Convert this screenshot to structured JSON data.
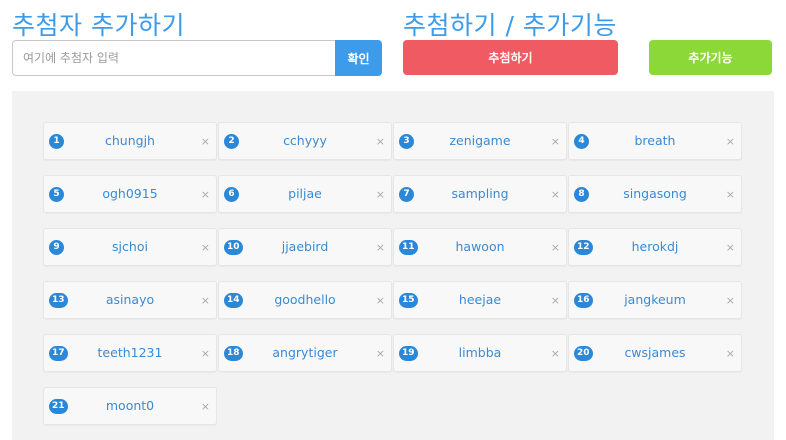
{
  "header": {
    "add_title": "추첨자 추가하기",
    "draw_title": "추첨하기 / 추가기능"
  },
  "add_form": {
    "placeholder": "여기에 추첨자 입력",
    "value": "",
    "confirm_label": "확인"
  },
  "actions": {
    "draw_label": "추첨하기",
    "extra_label": "추가기능"
  },
  "colors": {
    "accent": "#3d9be9",
    "draw": "#ef5a63",
    "extra": "#8bd838",
    "badge": "#2b88d8"
  },
  "participants": [
    {
      "num": "1",
      "name": "chungjh"
    },
    {
      "num": "2",
      "name": "cchyyy"
    },
    {
      "num": "3",
      "name": "zenigame"
    },
    {
      "num": "4",
      "name": "breath"
    },
    {
      "num": "5",
      "name": "ogh0915"
    },
    {
      "num": "6",
      "name": "piljae"
    },
    {
      "num": "7",
      "name": "sampling"
    },
    {
      "num": "8",
      "name": "singasong"
    },
    {
      "num": "9",
      "name": "sjchoi"
    },
    {
      "num": "10",
      "name": "jjaebird"
    },
    {
      "num": "11",
      "name": "hawoon"
    },
    {
      "num": "12",
      "name": "herokdj"
    },
    {
      "num": "13",
      "name": "asinayo"
    },
    {
      "num": "14",
      "name": "goodhello"
    },
    {
      "num": "15",
      "name": "heejae"
    },
    {
      "num": "16",
      "name": "jangkeum"
    },
    {
      "num": "17",
      "name": "teeth1231"
    },
    {
      "num": "18",
      "name": "angrytiger"
    },
    {
      "num": "19",
      "name": "limbba"
    },
    {
      "num": "20",
      "name": "cwsjames"
    },
    {
      "num": "21",
      "name": "moont0"
    }
  ],
  "remove_symbol": "×"
}
